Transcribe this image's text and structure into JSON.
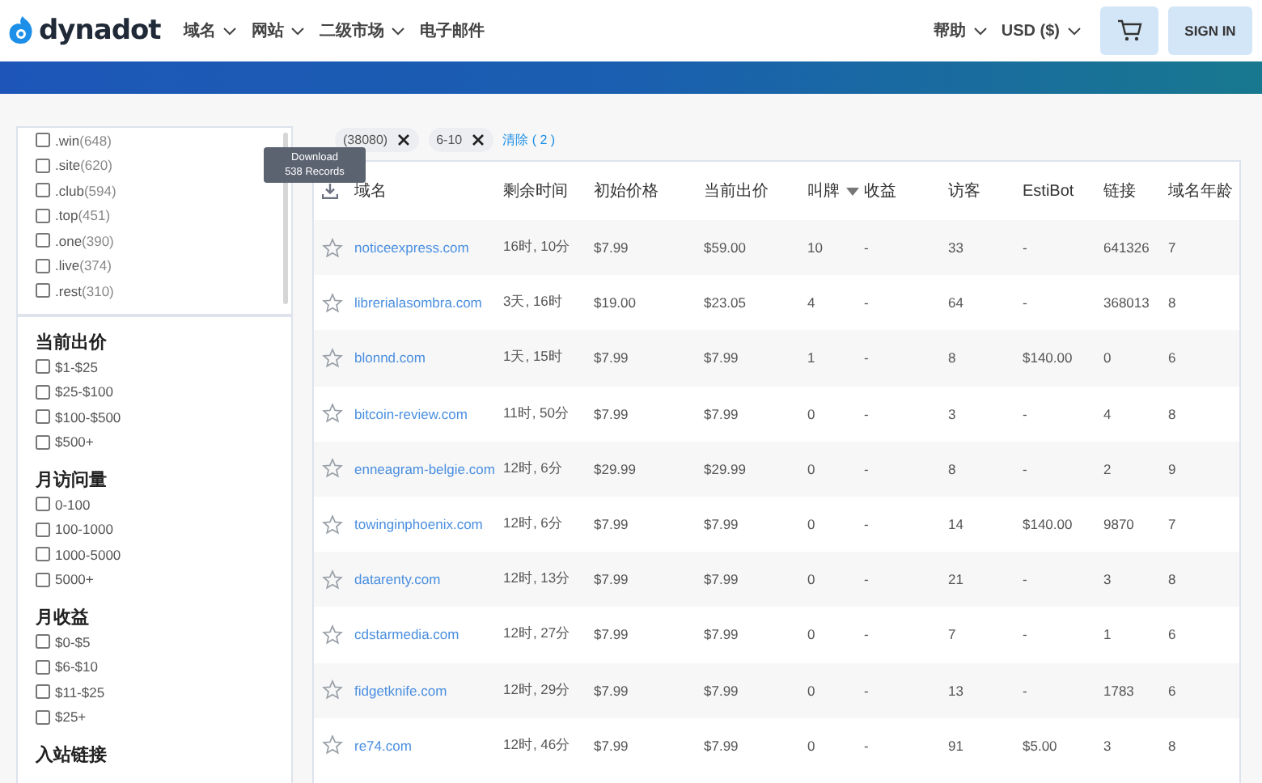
{
  "header": {
    "logo": "dynadot",
    "nav": [
      {
        "label": "域名",
        "dropdown": true
      },
      {
        "label": "网站",
        "dropdown": true
      },
      {
        "label": "二级市场",
        "dropdown": true
      },
      {
        "label": "电子邮件",
        "dropdown": false
      }
    ],
    "right": [
      {
        "label": "帮助",
        "dropdown": true
      },
      {
        "label": "USD ($)",
        "dropdown": true
      }
    ],
    "sign_in": "SIGN IN"
  },
  "sidebar": {
    "tld_list": [
      {
        "label": ".win",
        "count": "(648)",
        "checked": false
      },
      {
        "label": ".site",
        "count": "(620)",
        "checked": false
      },
      {
        "label": ".club",
        "count": "(594)",
        "checked": false
      },
      {
        "label": ".top",
        "count": "(451)",
        "checked": false
      },
      {
        "label": ".one",
        "count": "(390)",
        "checked": false
      },
      {
        "label": ".live",
        "count": "(374)",
        "checked": false
      },
      {
        "label": ".rest",
        "count": "(310)",
        "checked": false
      }
    ],
    "sections": [
      {
        "title": "当前出价",
        "options": [
          {
            "label": "$1-$25",
            "checked": false
          },
          {
            "label": "$25-$100",
            "checked": false
          },
          {
            "label": "$100-$500",
            "checked": false
          },
          {
            "label": "$500+",
            "checked": false
          }
        ]
      },
      {
        "title": "月访问量",
        "options": [
          {
            "label": "0-100",
            "checked": false
          },
          {
            "label": "100-1000",
            "checked": false
          },
          {
            "label": "1000-5000",
            "checked": false
          },
          {
            "label": "5000+",
            "checked": false
          }
        ]
      },
      {
        "title": "月收益",
        "options": [
          {
            "label": "$0-$5",
            "checked": false
          },
          {
            "label": "$6-$10",
            "checked": false
          },
          {
            "label": "$11-$25",
            "checked": false
          },
          {
            "label": "$25+",
            "checked": false
          }
        ]
      },
      {
        "title": "入站链接"
      }
    ]
  },
  "filters": {
    "chips": [
      "(38080)",
      "6-10"
    ],
    "clear": "清除 ( 2 )"
  },
  "tooltip": {
    "title": "Download",
    "subtitle": "538 Records"
  },
  "table": {
    "columns": [
      {
        "label": "域名",
        "sorted": false
      },
      {
        "label": "剩余时间",
        "sorted": false
      },
      {
        "label": "初始价格",
        "sorted": false
      },
      {
        "label": "当前出价",
        "sorted": false
      },
      {
        "label": "叫牌",
        "sorted": true
      },
      {
        "label": "收益",
        "sorted": false
      },
      {
        "label": "访客",
        "sorted": false
      },
      {
        "label": "EstiBot",
        "sorted": false
      },
      {
        "label": "链接",
        "sorted": false
      },
      {
        "label": "域名年龄",
        "sorted": false
      }
    ],
    "rows": [
      {
        "starred": false,
        "cells": [
          "noticeexpress.com",
          "16时, 10分",
          "$7.99",
          "$59.00",
          "10",
          "-",
          "33",
          "-",
          "641326",
          "7"
        ]
      },
      {
        "starred": false,
        "cells": [
          "librerialasombra.com",
          "3天, 16时",
          "$19.00",
          "$23.05",
          "4",
          "-",
          "64",
          "-",
          "368013",
          "8"
        ]
      },
      {
        "starred": false,
        "cells": [
          "blonnd.com",
          "1天, 15时",
          "$7.99",
          "$7.99",
          "1",
          "-",
          "8",
          "$140.00",
          "0",
          "6"
        ]
      },
      {
        "starred": false,
        "cells": [
          "bitcoin-review.com",
          "11时, 50分",
          "$7.99",
          "$7.99",
          "0",
          "-",
          "3",
          "-",
          "4",
          "8"
        ]
      },
      {
        "starred": false,
        "cells": [
          "enneagram-belgie.com",
          "12时, 6分",
          "$29.99",
          "$29.99",
          "0",
          "-",
          "8",
          "-",
          "2",
          "9"
        ]
      },
      {
        "starred": false,
        "cells": [
          "towinginphoenix.com",
          "12时, 6分",
          "$7.99",
          "$7.99",
          "0",
          "-",
          "14",
          "$140.00",
          "9870",
          "7"
        ]
      },
      {
        "starred": false,
        "cells": [
          "datarenty.com",
          "12时, 13分",
          "$7.99",
          "$7.99",
          "0",
          "-",
          "21",
          "-",
          "3",
          "8"
        ]
      },
      {
        "starred": false,
        "cells": [
          "cdstarmedia.com",
          "12时, 27分",
          "$7.99",
          "$7.99",
          "0",
          "-",
          "7",
          "-",
          "1",
          "6"
        ]
      },
      {
        "starred": false,
        "cells": [
          "fidgetknife.com",
          "12时, 29分",
          "$7.99",
          "$7.99",
          "0",
          "-",
          "13",
          "-",
          "1783",
          "6"
        ]
      },
      {
        "starred": false,
        "cells": [
          "re74.com",
          "12时, 46分",
          "$7.99",
          "$7.99",
          "0",
          "-",
          "91",
          "$5.00",
          "3",
          "8"
        ]
      }
    ]
  }
}
